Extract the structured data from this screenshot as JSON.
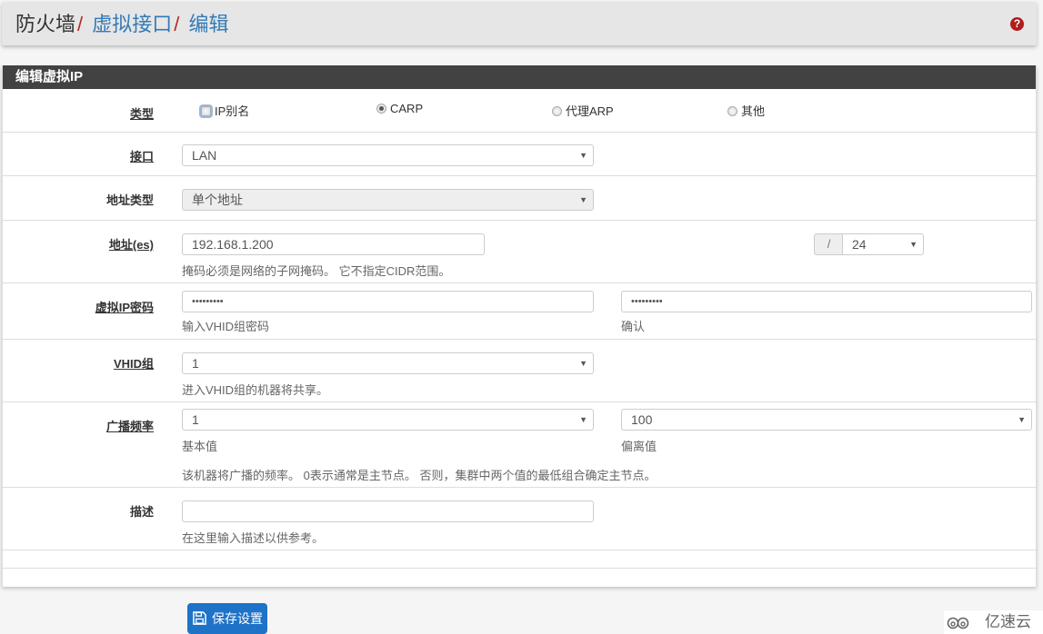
{
  "breadcrumb": {
    "root": "防火墙",
    "items": [
      "虚拟接口",
      "编辑"
    ],
    "separator": "/"
  },
  "help_icon": "question-circle-icon",
  "panel": {
    "title": "编辑虚拟IP"
  },
  "form": {
    "type": {
      "label": "类型",
      "options": [
        {
          "label": "IP别名",
          "checked": false,
          "focused": true
        },
        {
          "label": "CARP",
          "checked": true,
          "focused": false
        },
        {
          "label": "代理ARP",
          "checked": false,
          "focused": false
        },
        {
          "label": "其他",
          "checked": false,
          "focused": false
        }
      ]
    },
    "interface": {
      "label": "接口",
      "value": "LAN"
    },
    "address_type": {
      "label": "地址类型",
      "value": "单个地址",
      "disabled": true
    },
    "address": {
      "label": "地址(es)",
      "value": "192.168.1.200",
      "mask_separator": "/",
      "mask": "24",
      "help": "掩码必须是网络的子网掩码。 它不指定CIDR范围。"
    },
    "password": {
      "label": "虚拟IP密码",
      "value": "•••••••••",
      "confirm_value": "•••••••••",
      "help": "输入VHID组密码",
      "confirm_help": "确认"
    },
    "vhid": {
      "label": "VHID组",
      "value": "1",
      "help": "进入VHID组的机器将共享。"
    },
    "advertising": {
      "label": "广播频率",
      "base_value": "1",
      "base_help": "基本值",
      "skew_value": "100",
      "skew_help": "偏离值",
      "help": "该机器将广播的频率。 0表示通常是主节点。 否则，集群中两个值的最低组合确定主节点。"
    },
    "description": {
      "label": "描述",
      "value": "",
      "placeholder": "",
      "help": "在这里输入描述以供参考。"
    }
  },
  "save_button": {
    "label": "保存设置",
    "icon": "floppy-disk-icon"
  },
  "watermark": {
    "text": "亿速云",
    "icon": "cloud-logo-icon"
  }
}
